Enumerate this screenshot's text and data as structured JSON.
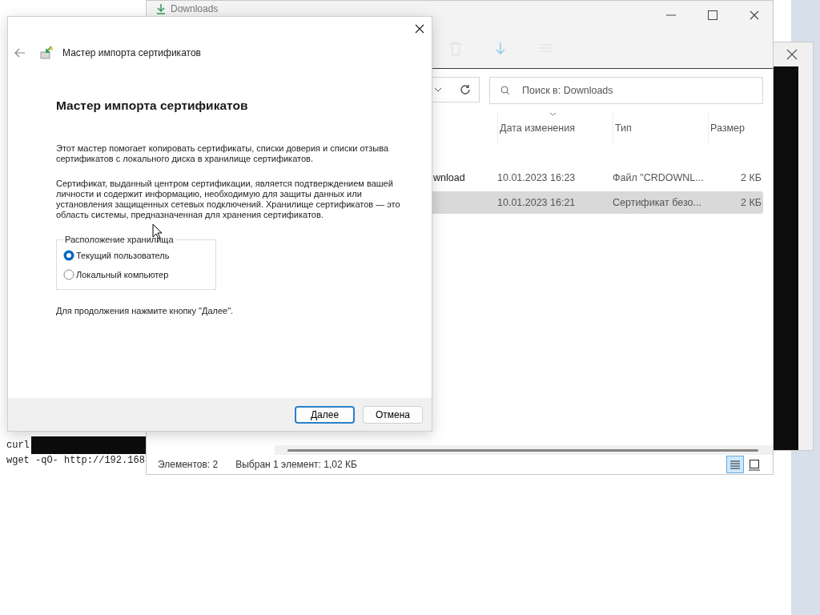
{
  "terminal": {
    "lines": [
      {
        "text": "curl",
        "redacted": true
      },
      {
        "text": "wget -qO- http://192.168",
        "redacted": false
      }
    ]
  },
  "explorer": {
    "title": "Downloads",
    "search": {
      "placeholder": "Поиск в: Downloads"
    },
    "columns": [
      {
        "label": "Дата изменения",
        "sorted": true
      },
      {
        "label": "Тип",
        "sorted": false
      },
      {
        "label": "Размер",
        "sorted": false
      }
    ],
    "rows": [
      {
        "name": "wnload",
        "date": "10.01.2023 16:23",
        "type": "Файл \"CRDOWNL...",
        "size": "2 КБ",
        "selected": false
      },
      {
        "date": "10.01.2023 16:21",
        "type": "Сертификат безо...",
        "size": "2 КБ",
        "selected": true
      }
    ],
    "status": {
      "count": "Элементов: 2",
      "selection": "Выбран 1 элемент: 1,02 КБ"
    },
    "views": [
      {
        "kind": "details",
        "selected": true
      },
      {
        "kind": "tiles",
        "selected": false
      }
    ]
  },
  "dialog": {
    "header_title": "Мастер импорта сертификатов",
    "heading": "Мастер импорта сертификатов",
    "paragraphs": [
      "Этот мастер помогает копировать сертификаты, списки доверия и списки отзыва сертификатов с локального диска в хранилище сертификатов.",
      "Сертификат, выданный центром сертификации, является подтверждением вашей личности и содержит информацию, необходимую для защиты данных или установления защищенных сетевых подключений. Хранилище сертификатов — это область системы, предназначенная для хранения сертификатов."
    ],
    "group": {
      "legend": "Расположение хранилища",
      "options": [
        {
          "label": "Текущий пользователь",
          "selected": true
        },
        {
          "label": "Локальный компьютер",
          "selected": false
        }
      ]
    },
    "hint": "Для продолжения нажмите кнопку \"Далее\".",
    "buttons": [
      {
        "label": "Далее",
        "default": true
      },
      {
        "label": "Отмена",
        "default": false
      }
    ]
  }
}
